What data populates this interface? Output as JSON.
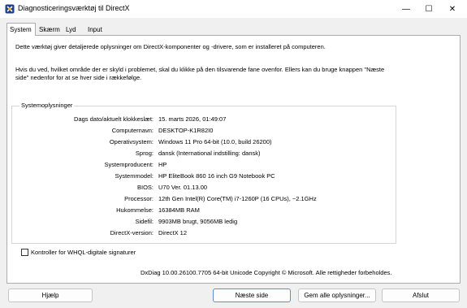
{
  "window": {
    "title": "Diagnosticeringsværktøj til DirectX",
    "minimize": "—",
    "maximize": "☐",
    "close": "✕"
  },
  "tabs": [
    "System",
    "Skærm",
    "Lyd",
    "Input"
  ],
  "intro": {
    "line1": "Dette værktøj giver detaljerede oplysninger om DirectX-komponenter og -drivere, som er installeret på computeren.",
    "line2": "Hvis du ved, hvilket område der er skyld i problemet, skal du klikke på den tilsvarende fane ovenfor. Ellers kan du bruge knappen \"Næste\nside\" nedenfor for at se hver side i rækkefølge."
  },
  "system_info": {
    "group_title": "Systemoplysninger",
    "rows": [
      {
        "label": "Dags dato/aktuelt klokkeslæt:",
        "value": "15. marts 2026, 01:49:07"
      },
      {
        "label": "Computernavn:",
        "value": "DESKTOP-K1R82I0"
      },
      {
        "label": "Operativsystem:",
        "value": "Windows 11 Pro 64-bit (10.0, build 26200)"
      },
      {
        "label": "Sprog:",
        "value": "dansk (International indstilling: dansk)"
      },
      {
        "label": "Systemproducent:",
        "value": "HP"
      },
      {
        "label": "Systemmodel:",
        "value": "HP EliteBook 860 16 inch G9 Notebook PC"
      },
      {
        "label": "BIOS:",
        "value": "U70 Ver. 01.13.00"
      },
      {
        "label": "Processor:",
        "value": "12th Gen Intel(R) Core(TM) i7-1260P (16 CPUs), ~2.1GHz"
      },
      {
        "label": "Hukommelse:",
        "value": "16384MB RAM"
      },
      {
        "label": "Sidefil:",
        "value": "9903MB brugt, 9056MB ledig"
      },
      {
        "label": "DirectX-version:",
        "value": "DirectX 12"
      }
    ]
  },
  "whql_checkbox": {
    "label": "Kontroller for WHQL-digitale signaturer",
    "checked": false
  },
  "footer": "DxDiag 10.00.26100.7705 64-bit Unicode  Copyright © Microsoft. Alle rettigheder forbeholdes.",
  "buttons": {
    "help": "Hjælp",
    "next": "Næste side",
    "save": "Gem alle oplysninger...",
    "exit": "Afslut"
  },
  "colors": {
    "window_bg": "#f0f0f0",
    "panel_bg": "#ffffff",
    "primary_border": "#5b8ed6"
  }
}
